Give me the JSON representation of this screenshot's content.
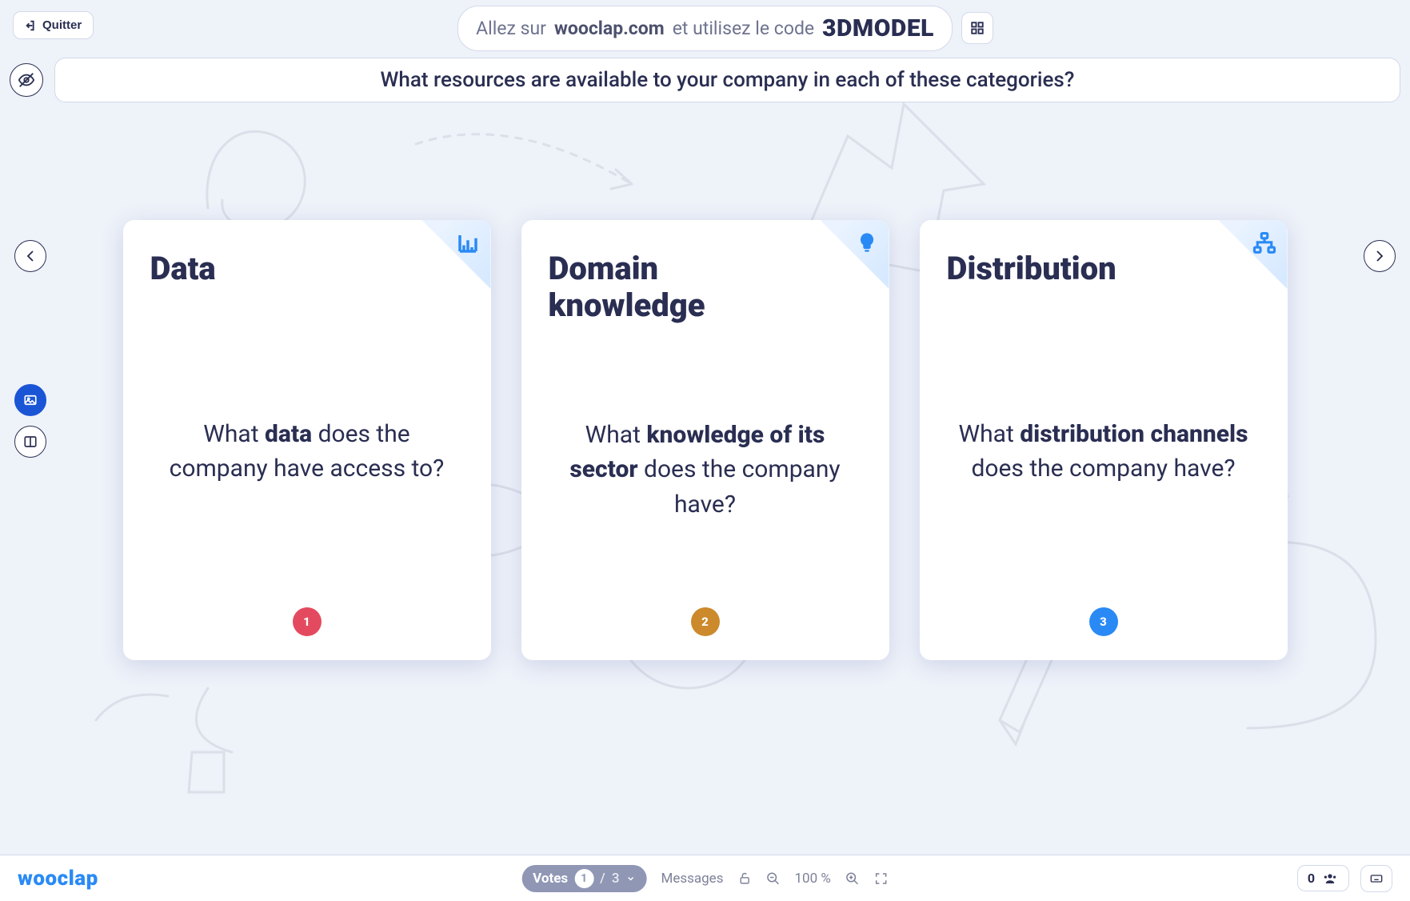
{
  "header": {
    "quit_label": "Quitter",
    "join_prefix": "Allez sur ",
    "join_domain": "wooclap.com",
    "join_mid": " et utilisez le code ",
    "join_code": "3DMODEL"
  },
  "question": "What resources are available to your company in each of these categories?",
  "cards": [
    {
      "title": "Data",
      "icon": "bar-chart-icon",
      "body_before": "What ",
      "body_bold": "data",
      "body_after": " does the company have access to?",
      "badge": "1",
      "badge_color": "#e44a5f"
    },
    {
      "title": "Domain knowledge",
      "icon": "lightbulb-icon",
      "body_before": "What ",
      "body_bold": "knowledge of its sector",
      "body_after": " does the company have?",
      "badge": "2",
      "badge_color": "#cc8a2c"
    },
    {
      "title": "Distribution",
      "icon": "network-icon",
      "body_before": "What ",
      "body_bold": "distribution channels",
      "body_after": " does the company have?",
      "badge": "3",
      "badge_color": "#2a8af5"
    }
  ],
  "footer": {
    "logo": "wooclap",
    "votes_label": "Votes",
    "votes_count": "1",
    "votes_total": "3",
    "messages_label": "Messages",
    "zoom_level": "100 %",
    "participants": "0"
  }
}
